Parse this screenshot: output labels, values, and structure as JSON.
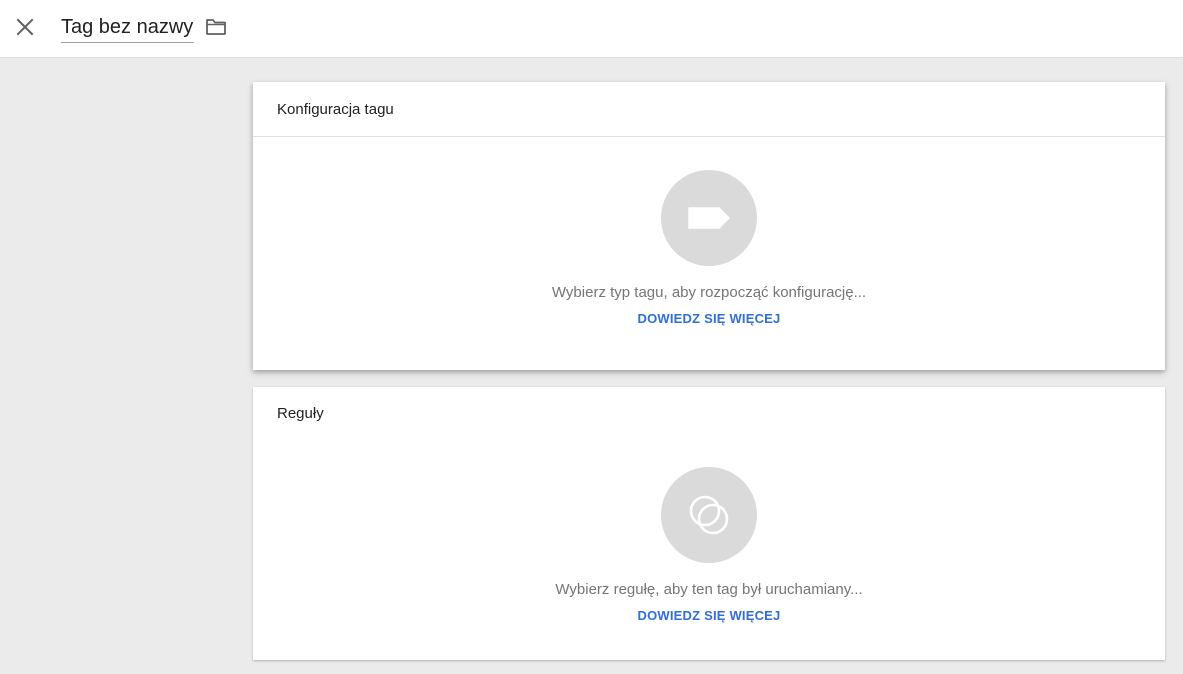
{
  "header": {
    "tag_name": "Tag bez nazwy",
    "close_icon": "close-icon",
    "folder_icon": "folder-icon"
  },
  "config_card": {
    "title": "Konfiguracja tagu",
    "icon": "tag-icon",
    "hint": "Wybierz typ tagu, aby rozpocząć konfigurację...",
    "learn_more": "DOWIEDZ SIĘ WIĘCEJ"
  },
  "rules_card": {
    "title": "Reguły",
    "icon": "trigger-rings-icon",
    "hint": "Wybierz regułę, aby ten tag był uruchamiany...",
    "learn_more": "DOWIEDZ SIĘ WIĘCEJ"
  },
  "colors": {
    "background": "#ebebeb",
    "link_blue": "#2f6fd6",
    "icon_circle": "#dadada",
    "hint_text": "#757575"
  }
}
